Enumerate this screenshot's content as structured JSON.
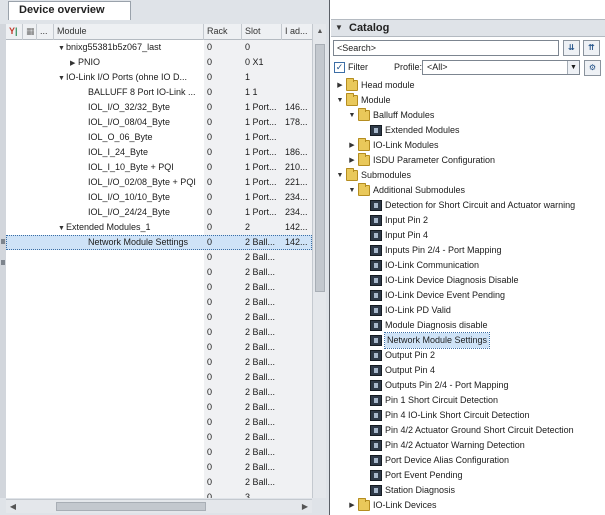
{
  "device_overview": {
    "tab_label": "Device overview",
    "columns": [
      "Module",
      "Rack",
      "Slot",
      "I ad..."
    ],
    "header_icons": [
      "filter-icon",
      "..."
    ],
    "rows": [
      {
        "module": "bnixg55381b5z067_last",
        "rack": "0",
        "slot": "0",
        "addr": "",
        "indent": 0,
        "expand": "down"
      },
      {
        "module": "PNIO",
        "rack": "0",
        "slot": "0 X1",
        "addr": "",
        "indent": 1,
        "expand": "right"
      },
      {
        "module": "IO-Link I/O Ports (ohne IO D...",
        "rack": "0",
        "slot": "1",
        "addr": "",
        "indent": 0,
        "expand": "down"
      },
      {
        "module": "BALLUFF 8 Port IO-Link ...",
        "rack": "0",
        "slot": "1 1",
        "addr": "",
        "indent": 1,
        "expand": ""
      },
      {
        "module": "IOL_I/O_32/32_Byte",
        "rack": "0",
        "slot": "1 Port...",
        "addr": "146...",
        "indent": 1,
        "expand": ""
      },
      {
        "module": "IOL_I/O_08/04_Byte",
        "rack": "0",
        "slot": "1 Port...",
        "addr": "178...",
        "indent": 1,
        "expand": ""
      },
      {
        "module": "IOL_O_06_Byte",
        "rack": "0",
        "slot": "1 Port...",
        "addr": "",
        "indent": 1,
        "expand": ""
      },
      {
        "module": "IOL_I_24_Byte",
        "rack": "0",
        "slot": "1 Port...",
        "addr": "186...",
        "indent": 1,
        "expand": ""
      },
      {
        "module": "IOL_I_10_Byte + PQI",
        "rack": "0",
        "slot": "1 Port...",
        "addr": "210...",
        "indent": 1,
        "expand": ""
      },
      {
        "module": "IOL_I/O_02/08_Byte + PQI",
        "rack": "0",
        "slot": "1 Port...",
        "addr": "221...",
        "indent": 1,
        "expand": ""
      },
      {
        "module": "IOL_I/O_10/10_Byte",
        "rack": "0",
        "slot": "1 Port...",
        "addr": "234...",
        "indent": 1,
        "expand": ""
      },
      {
        "module": "IOL_I/O_24/24_Byte",
        "rack": "0",
        "slot": "1 Port...",
        "addr": "234...",
        "indent": 1,
        "expand": ""
      },
      {
        "module": "Extended Modules_1",
        "rack": "0",
        "slot": "2",
        "addr": "142...",
        "indent": 0,
        "expand": "down"
      },
      {
        "module": "Network Module Settings",
        "rack": "0",
        "slot": "2 Ball...",
        "addr": "142...",
        "indent": 1,
        "expand": "",
        "selected": true
      },
      {
        "module": "",
        "rack": "0",
        "slot": "2 Ball...",
        "addr": "",
        "indent": 1,
        "expand": ""
      },
      {
        "module": "",
        "rack": "0",
        "slot": "2 Ball...",
        "addr": "",
        "indent": 1,
        "expand": ""
      },
      {
        "module": "",
        "rack": "0",
        "slot": "2 Ball...",
        "addr": "",
        "indent": 1,
        "expand": ""
      },
      {
        "module": "",
        "rack": "0",
        "slot": "2 Ball...",
        "addr": "",
        "indent": 1,
        "expand": ""
      },
      {
        "module": "",
        "rack": "0",
        "slot": "2 Ball...",
        "addr": "",
        "indent": 1,
        "expand": ""
      },
      {
        "module": "",
        "rack": "0",
        "slot": "2 Ball...",
        "addr": "",
        "indent": 1,
        "expand": ""
      },
      {
        "module": "",
        "rack": "0",
        "slot": "2 Ball...",
        "addr": "",
        "indent": 1,
        "expand": ""
      },
      {
        "module": "",
        "rack": "0",
        "slot": "2 Ball...",
        "addr": "",
        "indent": 1,
        "expand": ""
      },
      {
        "module": "",
        "rack": "0",
        "slot": "2 Ball...",
        "addr": "",
        "indent": 1,
        "expand": ""
      },
      {
        "module": "",
        "rack": "0",
        "slot": "2 Ball...",
        "addr": "",
        "indent": 1,
        "expand": ""
      },
      {
        "module": "",
        "rack": "0",
        "slot": "2 Ball...",
        "addr": "",
        "indent": 1,
        "expand": ""
      },
      {
        "module": "",
        "rack": "0",
        "slot": "2 Ball...",
        "addr": "",
        "indent": 1,
        "expand": ""
      },
      {
        "module": "",
        "rack": "0",
        "slot": "2 Ball...",
        "addr": "",
        "indent": 1,
        "expand": ""
      },
      {
        "module": "",
        "rack": "0",
        "slot": "2 Ball...",
        "addr": "",
        "indent": 1,
        "expand": ""
      },
      {
        "module": "",
        "rack": "0",
        "slot": "2 Ball...",
        "addr": "",
        "indent": 1,
        "expand": ""
      },
      {
        "module": "",
        "rack": "0",
        "slot": "2 Ball...",
        "addr": "",
        "indent": 1,
        "expand": ""
      },
      {
        "module": "",
        "rack": "0",
        "slot": "3",
        "addr": "",
        "indent": 1,
        "expand": ""
      }
    ]
  },
  "catalog": {
    "title": "Catalog",
    "search_placeholder": "<Search>",
    "filter_label": "Filter",
    "filter_checked": true,
    "profile_label": "Profile:",
    "profile_value": "<All>",
    "tree": [
      {
        "label": "Head module",
        "level": 0,
        "expand": "right",
        "icon": "folder"
      },
      {
        "label": "Module",
        "level": 0,
        "expand": "down",
        "icon": "folder"
      },
      {
        "label": "Balluff Modules",
        "level": 1,
        "expand": "down",
        "icon": "folder"
      },
      {
        "label": "Extended Modules",
        "level": 2,
        "expand": "",
        "icon": "module"
      },
      {
        "label": "IO-Link Modules",
        "level": 1,
        "expand": "right",
        "icon": "folder"
      },
      {
        "label": "ISDU Parameter Configuration",
        "level": 1,
        "expand": "right",
        "icon": "folder"
      },
      {
        "label": "Submodules",
        "level": 0,
        "expand": "down",
        "icon": "folder"
      },
      {
        "label": "Additional Submodules",
        "level": 1,
        "expand": "down",
        "icon": "folder"
      },
      {
        "label": "Detection for Short Circuit and Actuator warning",
        "level": 2,
        "expand": "",
        "icon": "module"
      },
      {
        "label": "Input Pin 2",
        "level": 2,
        "expand": "",
        "icon": "module"
      },
      {
        "label": "Input Pin 4",
        "level": 2,
        "expand": "",
        "icon": "module"
      },
      {
        "label": "Inputs Pin 2/4 - Port Mapping",
        "level": 2,
        "expand": "",
        "icon": "module"
      },
      {
        "label": "IO-Link Communication",
        "level": 2,
        "expand": "",
        "icon": "module"
      },
      {
        "label": "IO-Link Device Diagnosis Disable",
        "level": 2,
        "expand": "",
        "icon": "module"
      },
      {
        "label": "IO-Link Device Event Pending",
        "level": 2,
        "expand": "",
        "icon": "module"
      },
      {
        "label": "IO-Link PD Valid",
        "level": 2,
        "expand": "",
        "icon": "module"
      },
      {
        "label": "Module Diagnosis disable",
        "level": 2,
        "expand": "",
        "icon": "module"
      },
      {
        "label": "Network Module Settings",
        "level": 2,
        "expand": "",
        "icon": "module",
        "selected": true
      },
      {
        "label": "Output Pin 2",
        "level": 2,
        "expand": "",
        "icon": "module"
      },
      {
        "label": "Output Pin 4",
        "level": 2,
        "expand": "",
        "icon": "module"
      },
      {
        "label": "Outputs Pin 2/4 - Port Mapping",
        "level": 2,
        "expand": "",
        "icon": "module"
      },
      {
        "label": "Pin 1 Short Circuit Detection",
        "level": 2,
        "expand": "",
        "icon": "module"
      },
      {
        "label": "Pin 4 IO-Link Short Circuit Detection",
        "level": 2,
        "expand": "",
        "icon": "module"
      },
      {
        "label": "Pin 4/2 Actuator Ground Short Circuit Detection",
        "level": 2,
        "expand": "",
        "icon": "module"
      },
      {
        "label": "Pin 4/2 Actuator Warning Detection",
        "level": 2,
        "expand": "",
        "icon": "module"
      },
      {
        "label": "Port Device Alias Configuration",
        "level": 2,
        "expand": "",
        "icon": "module"
      },
      {
        "label": "Port Event Pending",
        "level": 2,
        "expand": "",
        "icon": "module"
      },
      {
        "label": "Station Diagnosis",
        "level": 2,
        "expand": "",
        "icon": "module"
      },
      {
        "label": "IO-Link Devices",
        "level": 1,
        "expand": "right",
        "icon": "folder"
      }
    ]
  },
  "colors": {
    "selection": "#cfe3f7",
    "pane_bg": "#dfe3e8",
    "folder": "#e9c85a",
    "module_icon": "#2f3a48"
  }
}
